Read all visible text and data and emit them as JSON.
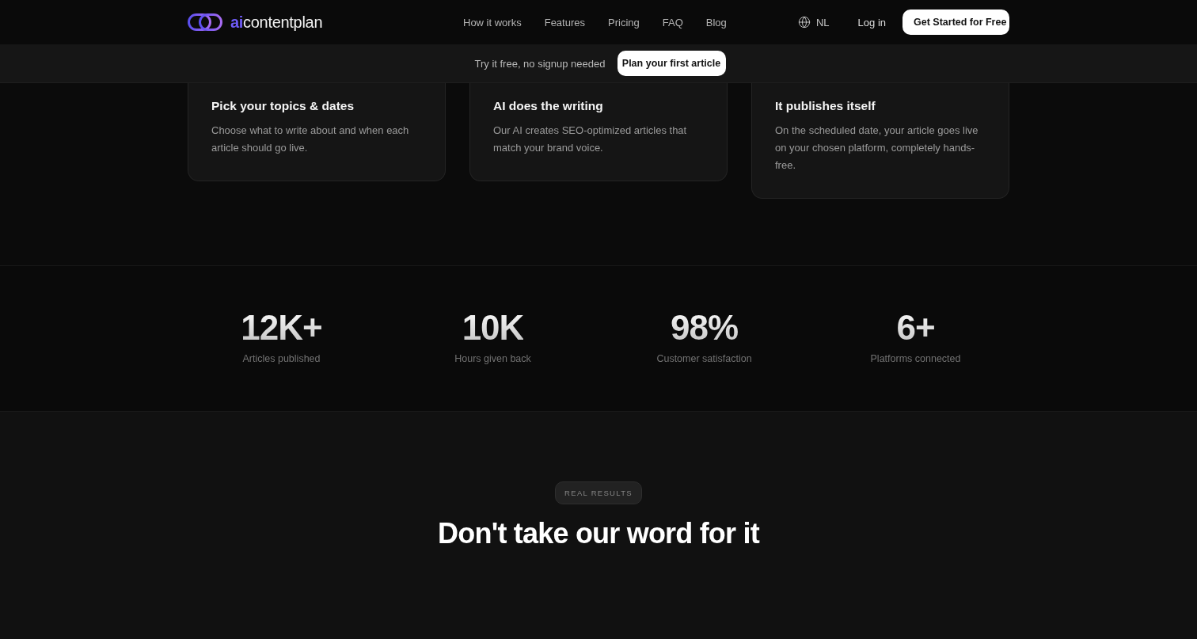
{
  "header": {
    "logo": {
      "accent": "ai",
      "name": "contentplan"
    },
    "nav": [
      "How it works",
      "Features",
      "Pricing",
      "FAQ",
      "Blog"
    ],
    "language": "NL",
    "login": "Log in",
    "cta": "Get Started for Free"
  },
  "promo_bar": {
    "text": "Try it free, no signup needed",
    "button": "Plan your first article"
  },
  "steps": [
    {
      "title": "Pick your topics & dates",
      "description": "Choose what to write about and when each article should go live."
    },
    {
      "title": "AI does the writing",
      "description": "Our AI creates SEO-optimized articles that match your brand voice."
    },
    {
      "title": "It publishes itself",
      "description": "On the scheduled date, your article goes live on your chosen platform, completely hands-free."
    }
  ],
  "stats": [
    {
      "value": "12K+",
      "label": "Articles published"
    },
    {
      "value": "10K",
      "label": "Hours given back"
    },
    {
      "value": "98%",
      "label": "Customer satisfaction"
    },
    {
      "value": "6+",
      "label": "Platforms connected"
    }
  ],
  "testimonials": {
    "badge": "REAL RESULTS",
    "heading": "Don't take our word for it"
  }
}
